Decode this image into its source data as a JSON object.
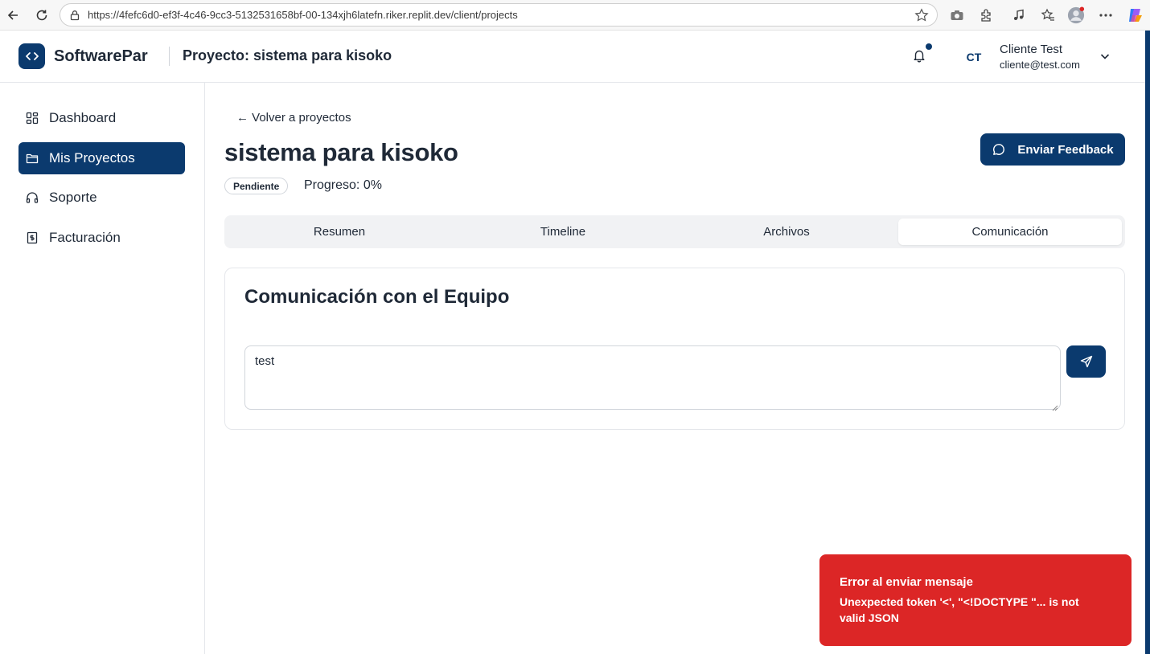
{
  "browser": {
    "url": "https://4fefc6d0-ef3f-4c46-9cc3-5132531658bf-00-134xjh6latefn.riker.replit.dev/client/projects"
  },
  "header": {
    "brand": "SoftwarePar",
    "project_title": "Proyecto: sistema para kisoko",
    "avatar_initials": "CT",
    "user_name": "Cliente Test",
    "user_email": "cliente@test.com"
  },
  "sidebar": {
    "items": [
      {
        "label": "Dashboard",
        "icon": "grid-icon",
        "active": false
      },
      {
        "label": "Mis Proyectos",
        "icon": "folder-icon",
        "active": true
      },
      {
        "label": "Soporte",
        "icon": "headphones-icon",
        "active": false
      },
      {
        "label": "Facturación",
        "icon": "receipt-icon",
        "active": false
      }
    ]
  },
  "main": {
    "back_link": "← Volver a proyectos",
    "title": "sistema para kisoko",
    "status": "Pendiente",
    "progress_text": "Progreso: 0%",
    "feedback_button": "Enviar Feedback",
    "tabs": [
      {
        "label": "Resumen",
        "active": false
      },
      {
        "label": "Timeline",
        "active": false
      },
      {
        "label": "Archivos",
        "active": false
      },
      {
        "label": "Comunicación",
        "active": true
      }
    ],
    "card_title": "Comunicación con el Equipo",
    "message_value": "test"
  },
  "toast": {
    "title": "Error al enviar mensaje",
    "body": "Unexpected token '<', \"<!DOCTYPE \"... is not valid JSON"
  },
  "colors": {
    "primary": "#0b3a6e",
    "error": "#dc2626",
    "tab_bg": "#f1f2f4"
  }
}
